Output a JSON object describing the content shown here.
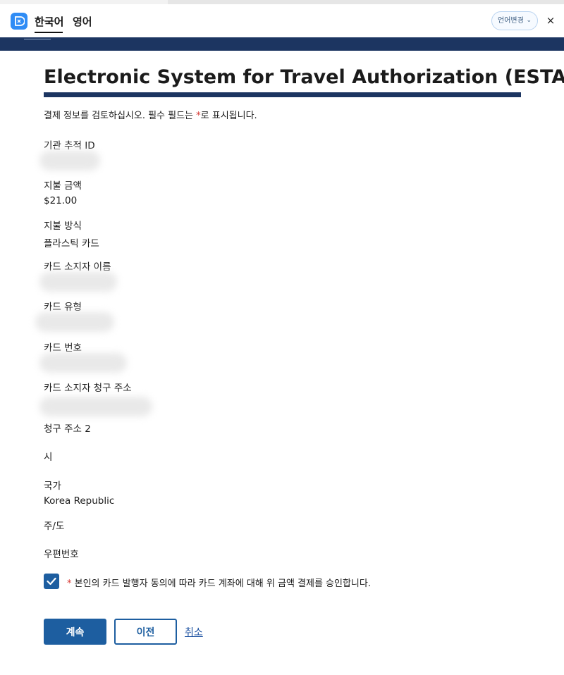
{
  "translate_bar": {
    "lang_korean": "한국어",
    "lang_english": "영어",
    "change_language": "언어변경",
    "close": "×"
  },
  "page": {
    "title": "Electronic System for Travel Authorization (ESTA)",
    "instructions_before": "결제 정보를 검토하십시오. 필수 필드는 ",
    "required_mark": "*",
    "instructions_after": "로 표시됩니다."
  },
  "fields": {
    "tracking_id": {
      "label": "기관 추적 ID",
      "value": ""
    },
    "payment_amount": {
      "label": "지불 금액",
      "value": "$21.00"
    },
    "payment_method": {
      "label": "지불 방식",
      "value": "플라스틱 카드"
    },
    "cardholder_name": {
      "label": "카드 소지자 이름",
      "value": ""
    },
    "card_type": {
      "label": "카드 유형",
      "value": ""
    },
    "card_number": {
      "label": "카드 번호",
      "value": ""
    },
    "billing_address": {
      "label": "카드 소지자 청구 주소",
      "value": ""
    },
    "billing_address_2": {
      "label": "청구 주소 2",
      "value": ""
    },
    "city": {
      "label": "시",
      "value": ""
    },
    "country": {
      "label": "국가",
      "value": "Korea Republic"
    },
    "state": {
      "label": "주/도",
      "value": ""
    },
    "postal_code": {
      "label": "우편번호",
      "value": ""
    }
  },
  "consent": {
    "required_mark": "*",
    "text": "본인의 카드 발행자 동의에 따라 카드 계좌에 대해 위 금액 결제를 승인합니다.",
    "checked": true
  },
  "actions": {
    "continue": "계속",
    "previous": "이전",
    "cancel": "취소"
  },
  "colors": {
    "navy": "#1c3561",
    "primary": "#1d5ea0",
    "required": "#d83933",
    "link": "#1a4fa0"
  }
}
